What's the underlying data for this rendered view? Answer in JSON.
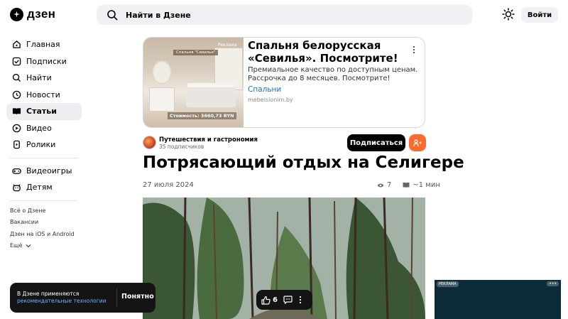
{
  "header": {
    "logo_text": "дзен",
    "search_placeholder": "Найти в Дзене",
    "login_label": "Войти"
  },
  "sidebar": {
    "items": [
      {
        "label": "Главная",
        "icon": "home-icon"
      },
      {
        "label": "Подписки",
        "icon": "subscriptions-icon"
      },
      {
        "label": "Найти",
        "icon": "search-icon"
      },
      {
        "label": "Новости",
        "icon": "news-icon"
      },
      {
        "label": "Статьи",
        "icon": "articles-icon",
        "active": true
      },
      {
        "label": "Видео",
        "icon": "video-icon"
      },
      {
        "label": "Ролики",
        "icon": "shorts-icon"
      }
    ],
    "items2": [
      {
        "label": "Видеоигры",
        "icon": "gamepad-icon"
      },
      {
        "label": "Детям",
        "icon": "kids-icon"
      }
    ],
    "footer": [
      "Всё о Дзене",
      "Вакансии",
      "Дзен на iOS и Android",
      "Ещё"
    ]
  },
  "ad": {
    "tag": "Реклама",
    "title": "Спальня белорусская «Севилья». Посмотрите!",
    "description": "Премиальное качество по доступным ценам. Рассрочка до 8 месяцев. Посмотрите!",
    "link": "Спальни",
    "domain": "mebelslonim.by",
    "image_plate": "Спальня \"Севилья\"",
    "image_price": "Стоимость: 3660,73 BYN"
  },
  "channel": {
    "name": "Путешествия и гастрономия",
    "subscribers": "35 подписчиков",
    "subscribe_label": "Подписаться"
  },
  "article": {
    "title": "Потрясающий отдых на Селигере",
    "date": "27 июля 2024",
    "views": "7",
    "read_time": "~1 мин"
  },
  "reactions": {
    "likes": "6"
  },
  "notice": {
    "text": "В Дзене применяются",
    "link": "рекомендательные технологии",
    "button": "Понятно"
  },
  "side_ad": {
    "tag": "РЕКЛАМА",
    "more": "•••"
  },
  "colors": {
    "accent_link": "#1a6bd8",
    "share_button": "#ff6b2c",
    "dark": "#141414"
  }
}
